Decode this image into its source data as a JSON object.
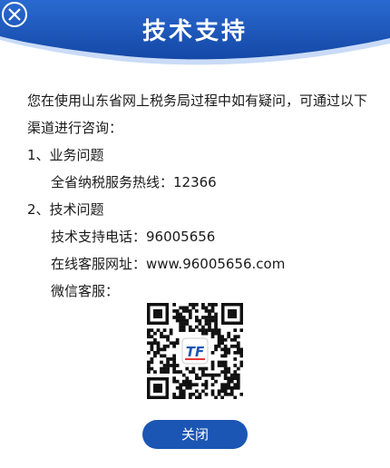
{
  "dialog": {
    "title": "技术支持",
    "close_icon": "close-circle-icon",
    "intro": "您在使用山东省网上税务局过程中如有疑问，可通过以下渠道进行咨询：",
    "section1": {
      "heading": "1、业务问题",
      "hotline": "全省纳税服务热线：12366"
    },
    "section2": {
      "heading": "2、技术问题",
      "phone": "技术支持电话：96005656",
      "website": "在线客服网址：www.96005656.com",
      "wechat": "微信客服："
    },
    "qr_logo_text": "TF",
    "close_button_label": "关闭"
  },
  "colors": {
    "header_blue": "#1b56b4",
    "header_light": "#3f7fe0",
    "logo_red": "#e53935"
  }
}
